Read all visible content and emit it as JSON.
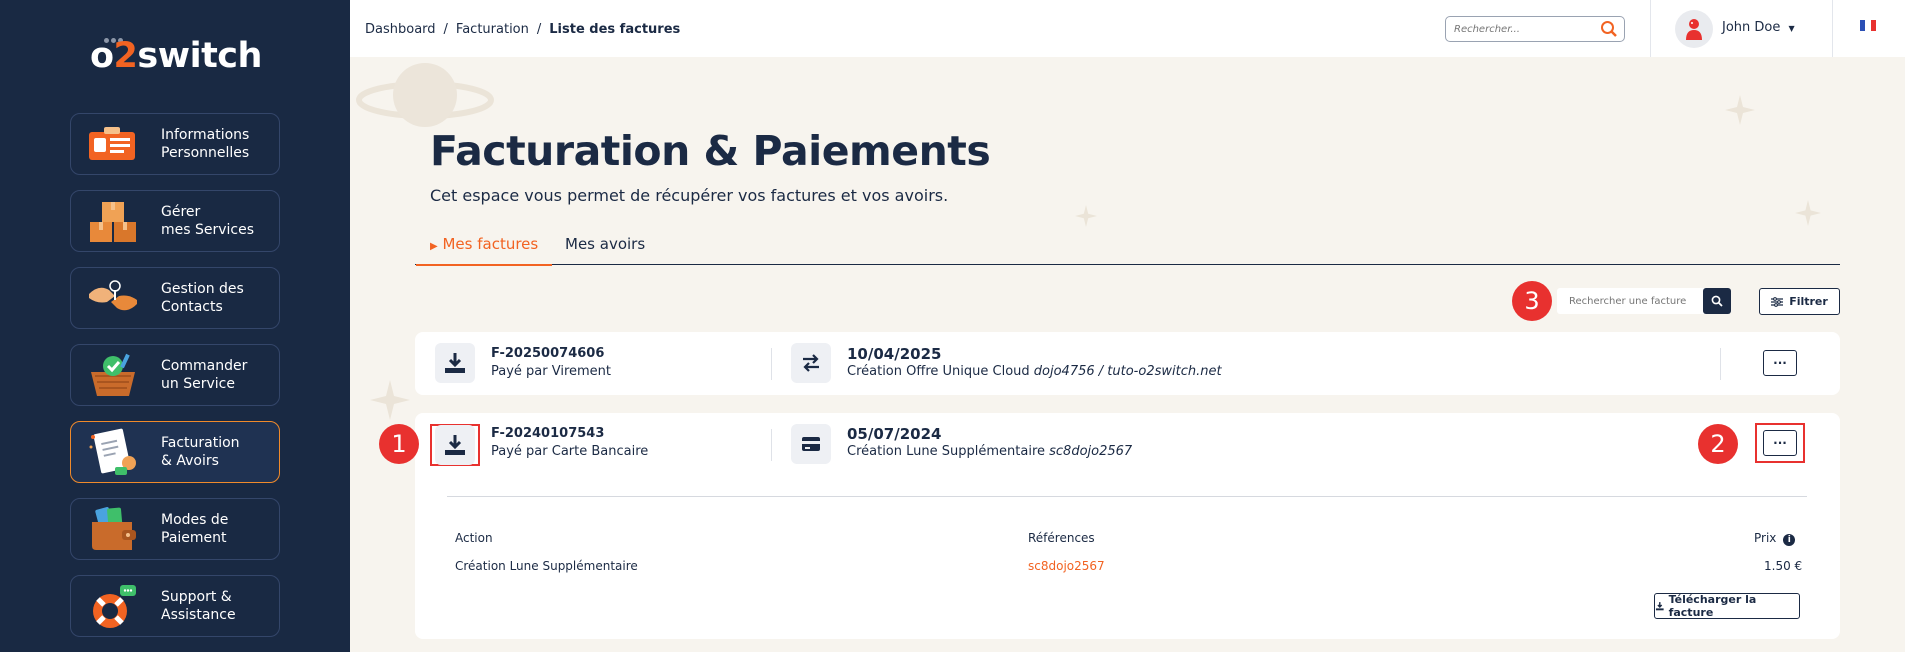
{
  "colors": {
    "sidebar_bg": "#192943",
    "accent_orange": "#f26322",
    "navy": "#1b2a44",
    "page_bg": "#f7f4ee",
    "annotation_red": "#e8312f"
  },
  "logo": {
    "text_before": "o",
    "text_accent": "2",
    "text_after": "switch"
  },
  "sidebar": {
    "items": [
      {
        "label": "Informations\nPersonnelles",
        "icon": "id-card-icon"
      },
      {
        "label": "Gérer\nmes Services",
        "icon": "boxes-icon"
      },
      {
        "label": "Gestion des\nContacts",
        "icon": "handshake-icon"
      },
      {
        "label": "Commander\nun Service",
        "icon": "basket-icon"
      },
      {
        "label": "Facturation\n& Avoirs",
        "icon": "invoice-icon",
        "active": true
      },
      {
        "label": "Modes de\nPaiement",
        "icon": "wallet-icon"
      },
      {
        "label": "Support &\nAssistance",
        "icon": "lifebuoy-icon"
      }
    ]
  },
  "topbar": {
    "breadcrumb": [
      "Dashboard",
      "Facturation",
      "Liste des factures"
    ],
    "search_placeholder": "Rechercher...",
    "username": "John Doe"
  },
  "main": {
    "title": "Facturation & Paiements",
    "subtitle": "Cet espace vous permet de récupérer vos factures et vos avoirs.",
    "tabs": [
      {
        "label": "Mes factures",
        "active": true
      },
      {
        "label": "Mes avoirs",
        "active": false
      }
    ],
    "search_invoice_placeholder": "Rechercher une facture",
    "filter_label": "Filtrer"
  },
  "invoices": [
    {
      "number": "F-20250074606",
      "payment": "Payé par Virement",
      "date": "10/04/2025",
      "description": "Création Offre Unique Cloud ",
      "description_ref": "dojo4756 / tuto-o2switch.net",
      "more": "···"
    },
    {
      "number": "F-20240107543",
      "payment": "Payé par Carte Bancaire",
      "date": "05/07/2024",
      "description": "Création Lune Supplémentaire ",
      "description_ref": "sc8dojo2567",
      "more": "···",
      "details": {
        "headers": {
          "action": "Action",
          "references": "Références",
          "price": "Prix"
        },
        "rows": [
          {
            "action": "Création Lune Supplémentaire",
            "reference": "sc8dojo2567",
            "price": "1.50 €"
          }
        ],
        "download_label": "Télécharger la facture"
      }
    }
  ],
  "annotations": [
    "1",
    "2",
    "3"
  ]
}
